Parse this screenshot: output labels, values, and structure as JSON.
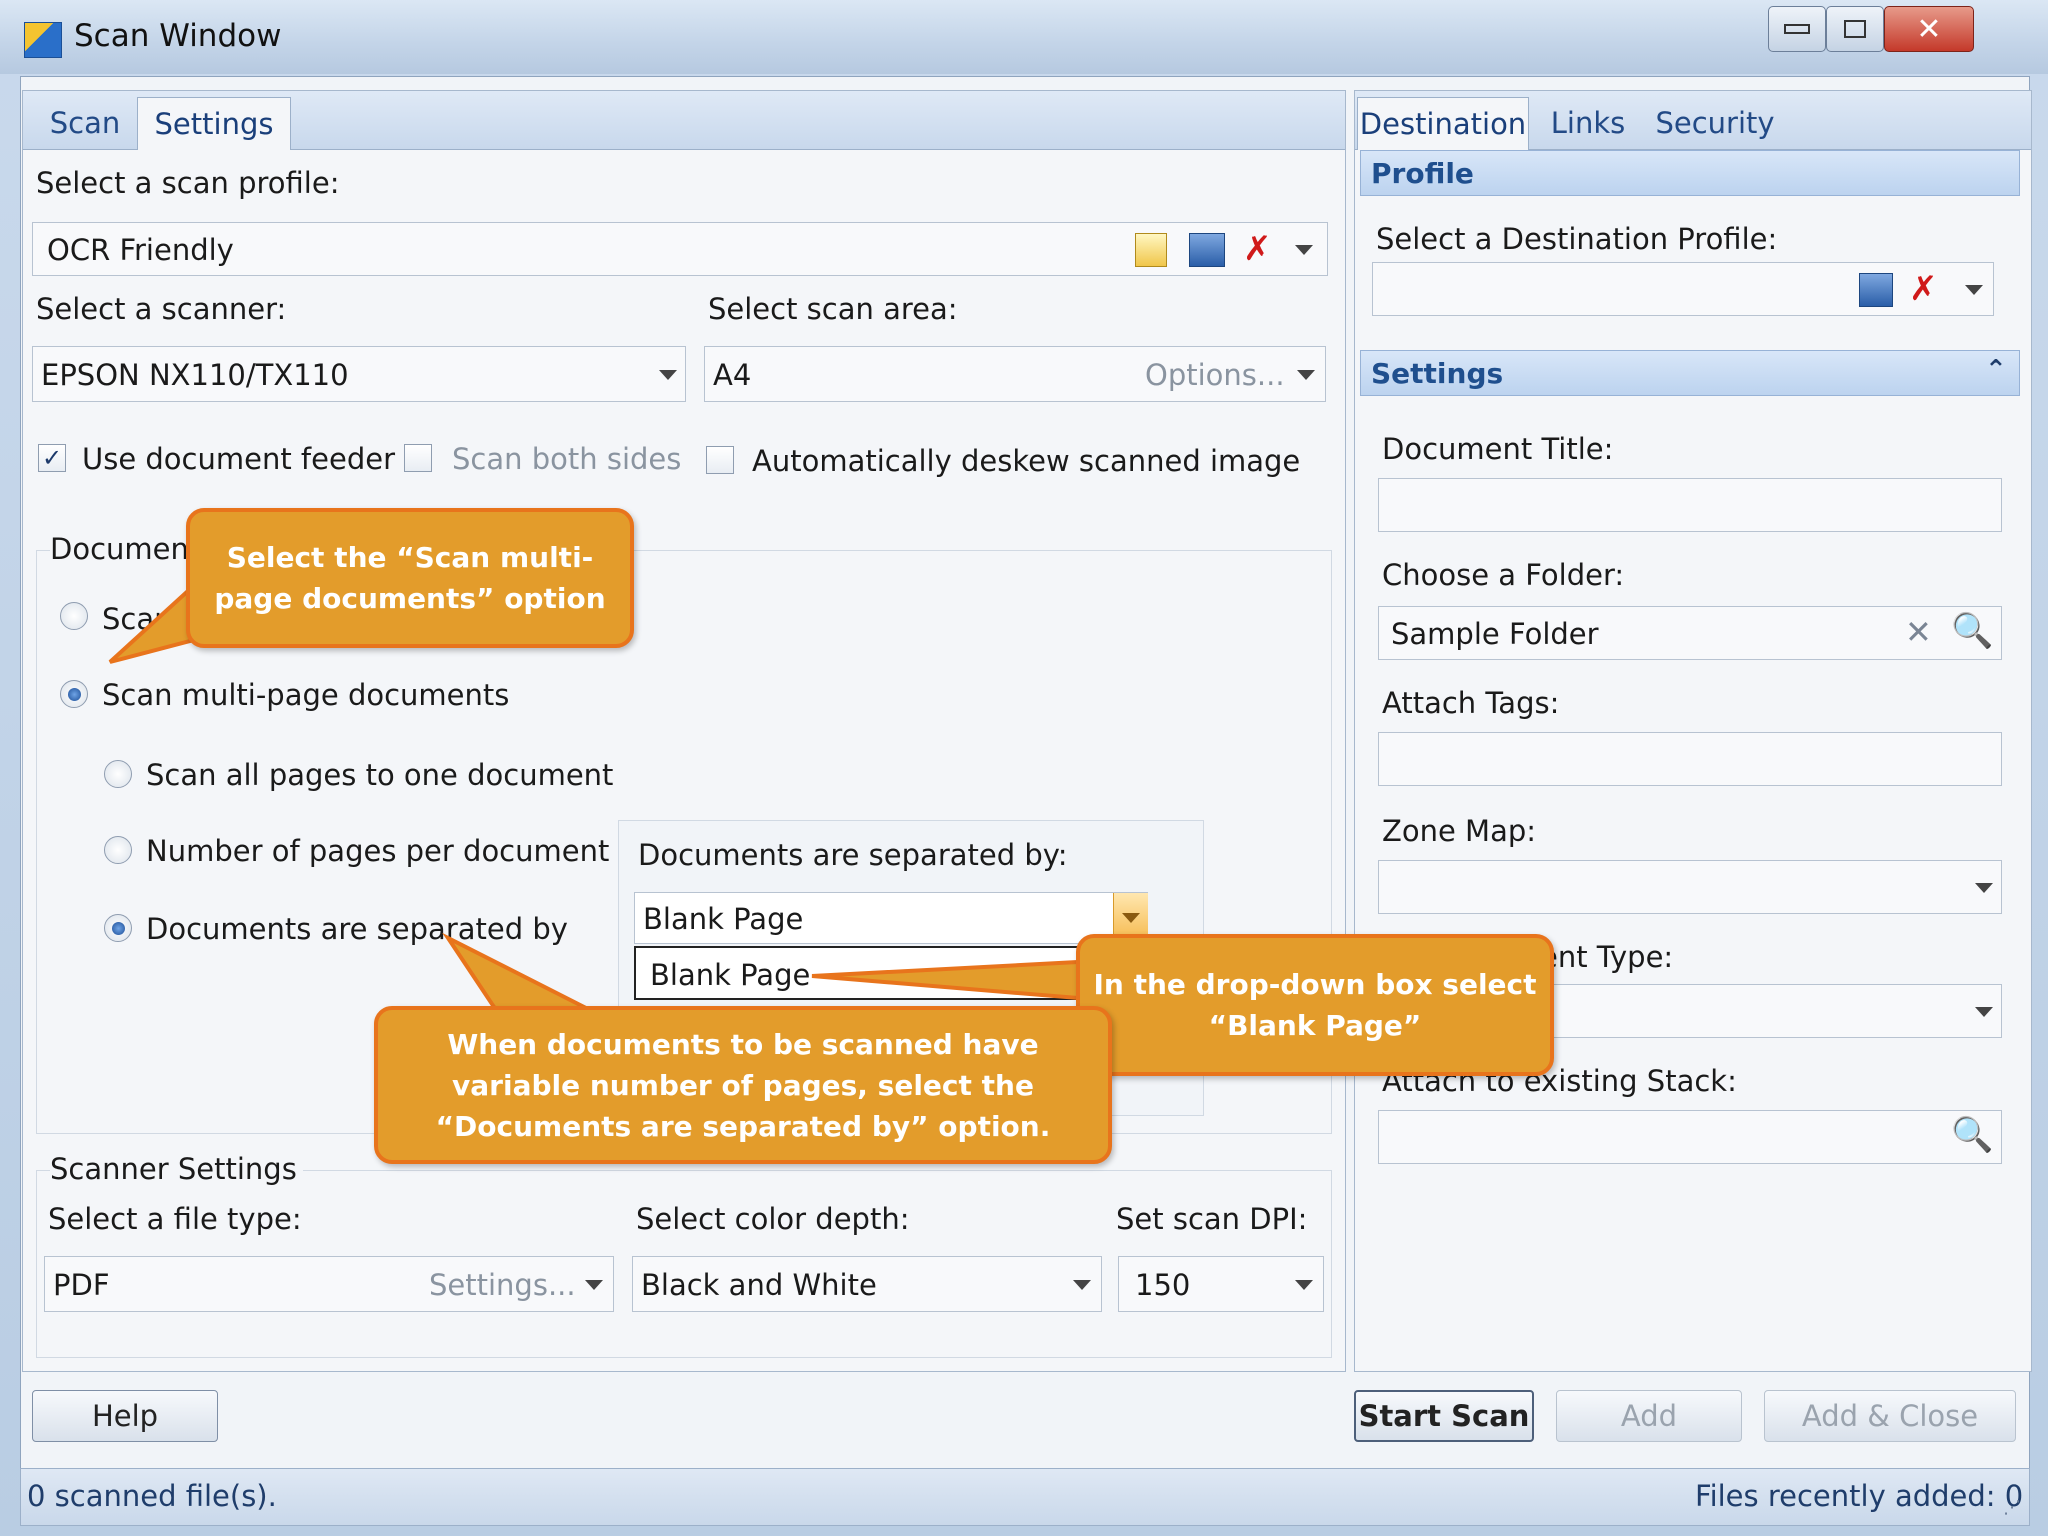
{
  "window": {
    "title": "Scan Window"
  },
  "left_tabs": [
    "Scan",
    "Settings"
  ],
  "right_tabs": [
    "Destination",
    "Links",
    "Security"
  ],
  "scan_profile": {
    "label": "Select a scan profile:",
    "value": "OCR Friendly"
  },
  "scanner": {
    "label": "Select a scanner:",
    "value": "EPSON NX110/TX110"
  },
  "scan_area": {
    "label": "Select scan area:",
    "value": "A4",
    "options_label": "Options..."
  },
  "checks": {
    "feeder": {
      "label": "Use document feeder",
      "checked": true
    },
    "both_sides": {
      "label": "Scan both sides",
      "checked": false
    },
    "deskew": {
      "label": "Automatically deskew scanned image",
      "checked": false
    }
  },
  "documents": {
    "group_label": "Document",
    "single_label_partial": "Scan",
    "multi_label": "Scan multi-page documents",
    "all_pages_label": "Scan all pages to one document",
    "per_doc_label": "Number of pages per document",
    "separated_label": "Documents are separated by"
  },
  "separator": {
    "label": "Documents are separated by:",
    "value": "Blank Page",
    "open_option": "Blank Page"
  },
  "scanner_settings": {
    "group_label": "Scanner Settings",
    "file_type_label": "Select a file type:",
    "file_type_value": "PDF",
    "file_type_settings": "Settings...",
    "color_label": "Select color depth:",
    "color_value": "Black and White",
    "dpi_label": "Set scan DPI:",
    "dpi_value": "150"
  },
  "destination": {
    "profile_header": "Profile",
    "profile_label": "Select a Destination Profile:",
    "settings_header": "Settings",
    "doc_title_label": "Document Title:",
    "folder_label": "Choose a Folder:",
    "folder_value": "Sample Folder",
    "tags_label": "Attach Tags:",
    "zone_label": "Zone Map:",
    "doc_type_label_partial": "ent Type:",
    "stack_label_partial": "Attach to existing Stack:"
  },
  "buttons": {
    "help": "Help",
    "start_scan": "Start Scan",
    "add": "Add",
    "add_close": "Add & Close"
  },
  "status": {
    "left": "0 scanned file(s).",
    "right": "Files recently added: 0"
  },
  "callouts": {
    "multi_page": "Select the “Scan multi-page documents” option",
    "blank_page": "In the drop-down box select “Blank Page”",
    "separated": "When documents to be scanned have variable number of pages, select the “Documents are separated by” option."
  },
  "colors": {
    "callout_fill": "#e39c2b",
    "callout_border": "#e8741c",
    "header_text": "#1f4f8e"
  }
}
